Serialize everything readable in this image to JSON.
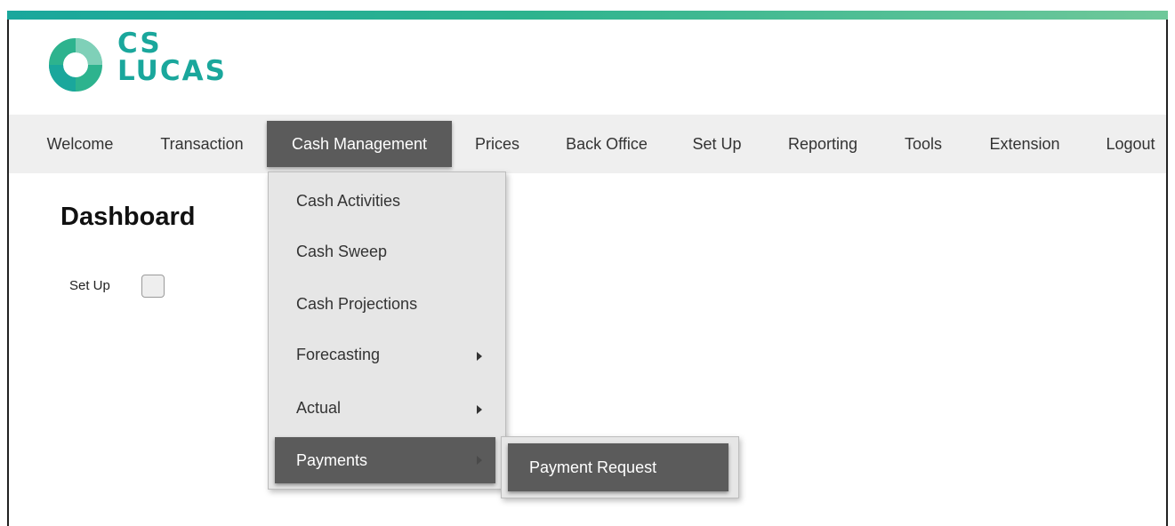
{
  "brand": {
    "line1": "CS",
    "line2": "LUCAS",
    "teal": "#1aa79c",
    "green": "#2db38e"
  },
  "nav": {
    "items": [
      {
        "label": "Welcome"
      },
      {
        "label": "Transaction"
      },
      {
        "label": "Cash Management",
        "active": true
      },
      {
        "label": "Prices"
      },
      {
        "label": "Back Office"
      },
      {
        "label": "Set Up"
      },
      {
        "label": "Reporting"
      },
      {
        "label": "Tools"
      },
      {
        "label": "Extension"
      },
      {
        "label": "Logout"
      }
    ],
    "active_color": "#5b5b5b"
  },
  "page": {
    "title": "Dashboard",
    "setup_label": "Set Up",
    "setup_checked": false
  },
  "dropdown": {
    "items": [
      {
        "label": "Cash Activities"
      },
      {
        "label": "Cash Sweep"
      },
      {
        "label": "Cash Projections"
      },
      {
        "label": "Forecasting",
        "has_submenu": true
      },
      {
        "label": "Actual",
        "has_submenu": true
      },
      {
        "label": "Payments",
        "has_submenu": true,
        "active": true
      }
    ]
  },
  "submenu": {
    "items": [
      {
        "label": "Payment Request",
        "active": true
      }
    ]
  },
  "icons": {
    "logo": "donut-logo-icon",
    "submenu_arrow": "caret-right-icon"
  }
}
